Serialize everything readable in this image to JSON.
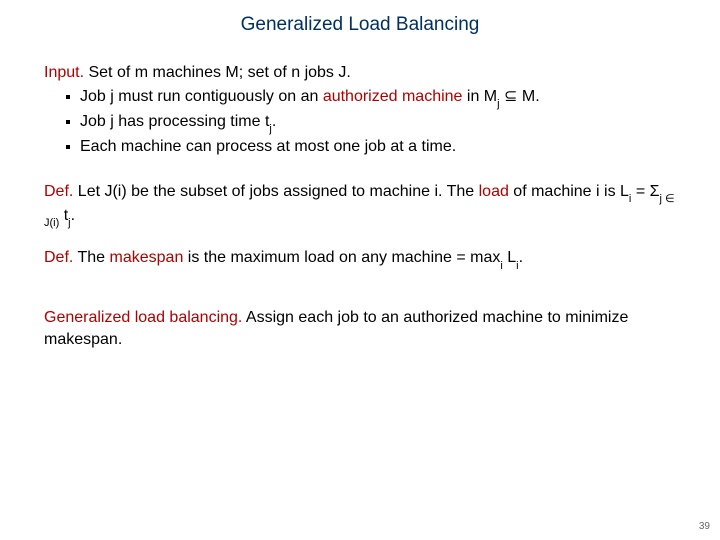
{
  "title": "Generalized Load Balancing",
  "input_label": "Input.",
  "input_rest": "  Set of m machines M; set of n jobs J.",
  "bul1_a": "Job j must run contiguously on an ",
  "bul1_red": "authorized machine",
  "bul1_b": " in M",
  "bul1_sub": "j",
  "bul1_c": " ",
  "bul1_subset": "⊆",
  "bul1_d": " M.",
  "bul2_a": "Job j has processing time t",
  "bul2_sub": "j",
  "bul2_b": ".",
  "bul3": "Each machine can process at most one job at a time.",
  "def1_label": "Def.",
  "def1_a": "  Let J(i) be the subset of jobs assigned to machine i.  The ",
  "def1_red": "load",
  "def1_b": " of machine i is L",
  "def1_sub1": "i",
  "def1_c": " = ",
  "def1_sigma": "Σ",
  "def1_sub2": "j ∈ J(i)",
  "def1_d": " t",
  "def1_sub3": "j",
  "def1_e": ".",
  "def2_label": "Def.",
  "def2_a": " The ",
  "def2_red": "makespan",
  "def2_b": " is the maximum load on any machine = max",
  "def2_sub1": "i",
  "def2_c": " L",
  "def2_sub2": "i",
  "def2_d": ".",
  "glb_red": "Generalized load balancing.",
  "glb_rest": "  Assign each job to an authorized machine to minimize makespan.",
  "page_number": "39"
}
